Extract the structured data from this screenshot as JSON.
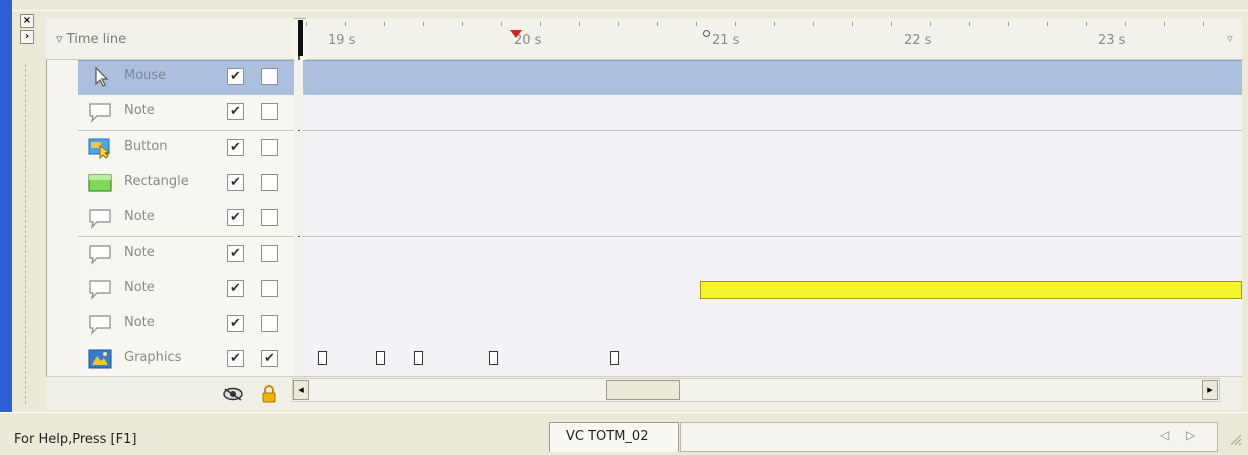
{
  "timeline": {
    "title": "Time line",
    "ruler_labels": [
      "19 s",
      "20 s",
      "21 s",
      "22 s",
      "23 s"
    ]
  },
  "rows": [
    {
      "label": "Mouse",
      "icon": "cursor-icon",
      "visible": true,
      "locked": false,
      "selected": true
    },
    {
      "label": "Note",
      "icon": "note-icon",
      "visible": true,
      "locked": false
    },
    {
      "label": "Button",
      "icon": "button-icon",
      "visible": true,
      "locked": false
    },
    {
      "label": "Rectangle",
      "icon": "rectangle-icon",
      "visible": true,
      "locked": false
    },
    {
      "label": "Note",
      "icon": "note-icon",
      "visible": true,
      "locked": false
    },
    {
      "label": "Note",
      "icon": "note-icon",
      "visible": true,
      "locked": false
    },
    {
      "label": "Note",
      "icon": "note-icon",
      "visible": true,
      "locked": false
    },
    {
      "label": "Note",
      "icon": "note-icon",
      "visible": true,
      "locked": false
    },
    {
      "label": "Graphics",
      "icon": "graphics-icon",
      "visible": true,
      "locked": true
    }
  ],
  "status": {
    "help_text": "For Help,Press [F1]",
    "doc_tab": "VC TOTM_02"
  },
  "colors": {
    "selection": "#adbfdf",
    "note_bar": "#f4f42b",
    "marker": "#cc2a1c"
  }
}
